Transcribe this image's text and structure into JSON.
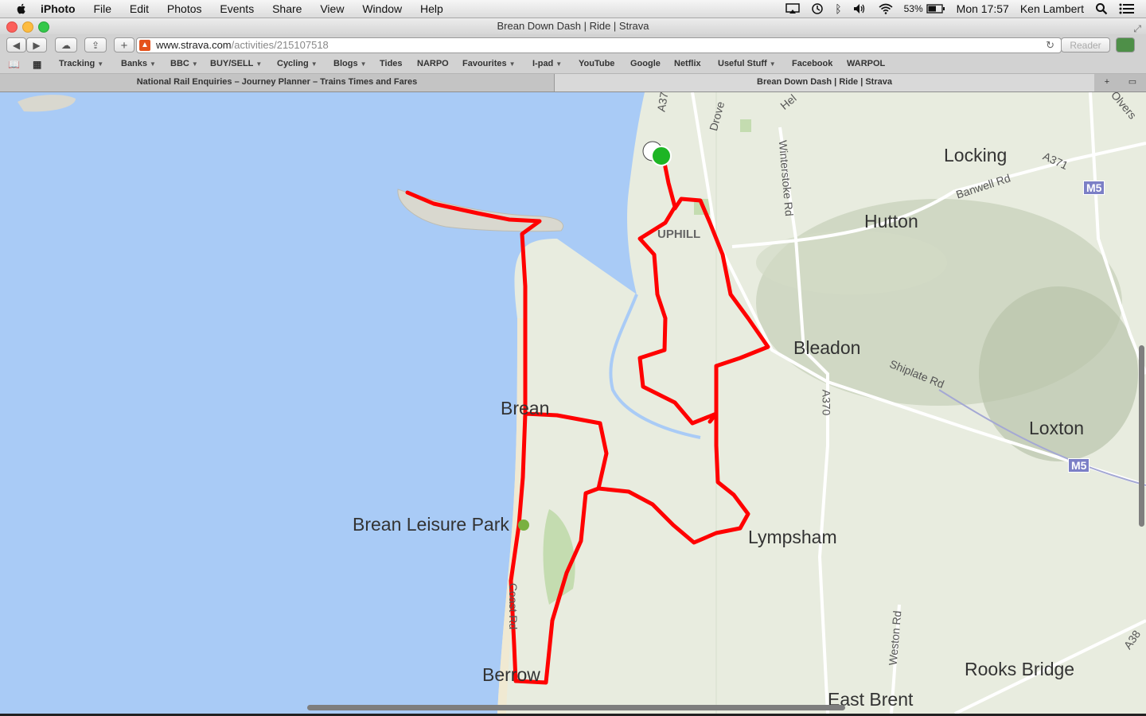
{
  "menubar": {
    "app": "iPhoto",
    "items": [
      "File",
      "Edit",
      "Photos",
      "Events",
      "Share",
      "View",
      "Window",
      "Help"
    ],
    "battery": "53%",
    "clock": "Mon 17:57",
    "user": "Ken Lambert",
    "icons": [
      "airplay-icon",
      "time-machine-icon",
      "bluetooth-icon",
      "volume-icon",
      "wifi-icon",
      "battery-icon",
      "spotlight-icon",
      "notification-icon"
    ]
  },
  "window": {
    "title": "Brean Down Dash | Ride | Strava"
  },
  "toolbar": {
    "url_host": "www.strava.com",
    "url_path": "/activities/215107518",
    "reader_label": "Reader",
    "add_label": "+"
  },
  "bookmarks": [
    {
      "label": "Tracking",
      "menu": true
    },
    {
      "label": "Banks",
      "menu": true
    },
    {
      "label": "BBC",
      "menu": true
    },
    {
      "label": "BUY/SELL",
      "menu": true
    },
    {
      "label": "Cycling",
      "menu": true
    },
    {
      "label": "Blogs",
      "menu": true
    },
    {
      "label": "Tides",
      "menu": false
    },
    {
      "label": "NARPO",
      "menu": false
    },
    {
      "label": "Favourites",
      "menu": true
    },
    {
      "label": "I-pad",
      "menu": true
    },
    {
      "label": "YouTube",
      "menu": false
    },
    {
      "label": "Google",
      "menu": false
    },
    {
      "label": "Netflix",
      "menu": false
    },
    {
      "label": "Useful Stuff",
      "menu": true
    },
    {
      "label": "Facebook",
      "menu": false
    },
    {
      "label": "WARPOL",
      "menu": false
    }
  ],
  "tabs": [
    {
      "label": "National Rail Enquiries – Journey Planner – Trains Times and Fares",
      "active": false
    },
    {
      "label": "Brean Down Dash | Ride | Strava",
      "active": true
    }
  ],
  "map": {
    "places": {
      "locking": "Locking",
      "hutton": "Hutton",
      "bleadon": "Bleadon",
      "brean": "Brean",
      "brean_leisure_park": "Brean Leisure Park",
      "lympsham": "Lympsham",
      "loxton": "Loxton",
      "berrow": "Berrow",
      "rooks_bridge": "Rooks Bridge",
      "east_brent": "East Brent",
      "uphill": "UPHILL"
    },
    "roads": {
      "a371": "A371",
      "banwell_rd": "Banwell Rd",
      "winterstoke_rd": "Winterstoke Rd",
      "drove_rd": "Drove",
      "shiplate_rd": "Shiplate Rd",
      "a370": "A370",
      "weston_rd": "Weston Rd",
      "coast_rd": "Coast Rd",
      "a37": "A37",
      "a38": "A38",
      "hel": "Hel",
      "olvers": "Olvers"
    },
    "shields": [
      "M5",
      "M5"
    ],
    "route_color": "#ff0000",
    "start_marker_color": "#1db524"
  }
}
